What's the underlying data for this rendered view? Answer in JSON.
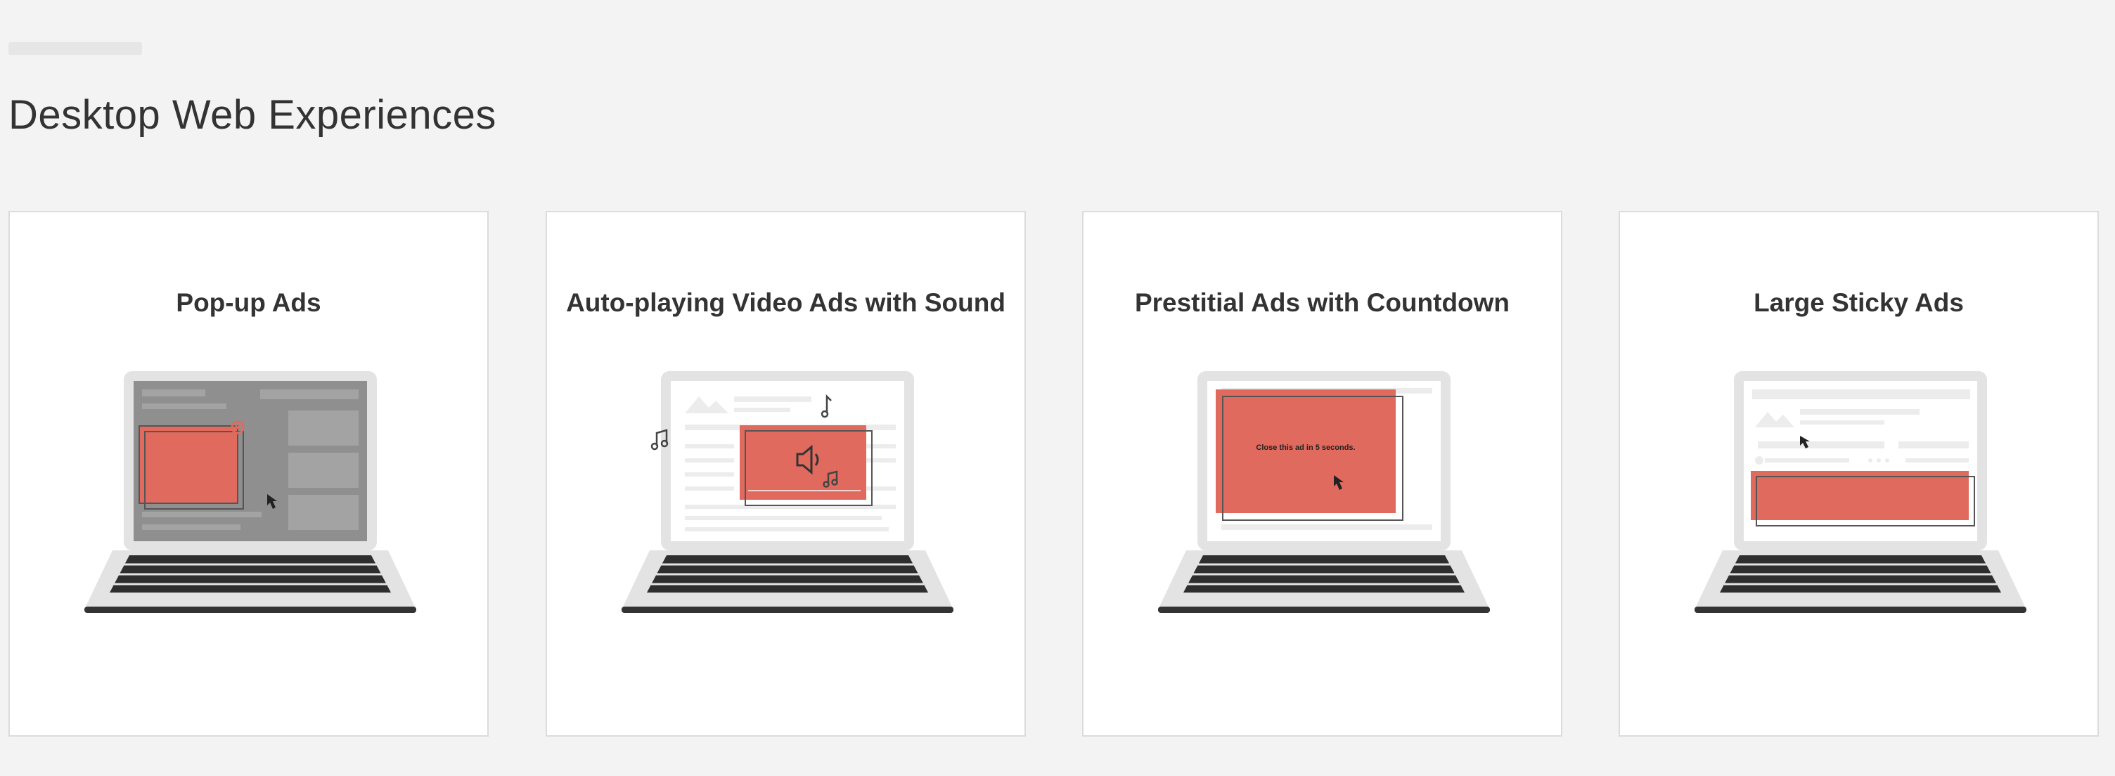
{
  "page": {
    "section_title": "Desktop Web Experiences"
  },
  "cards": [
    {
      "title": "Pop-up Ads",
      "illustration": "laptop-popup-ad"
    },
    {
      "title": "Auto-playing Video Ads with Sound",
      "illustration": "laptop-autoplay-video"
    },
    {
      "title": "Prestitial Ads with Countdown",
      "illustration": "laptop-prestitial-countdown",
      "ad_text": "Close this ad in 5 seconds."
    },
    {
      "title": "Large Sticky Ads",
      "illustration": "laptop-sticky-ad"
    }
  ],
  "colors": {
    "ad_red": "#e06a5e",
    "laptop_gray": "#e3e3e3",
    "keyboard": "#2e2e2e",
    "page_background": "#f3f3f3"
  }
}
